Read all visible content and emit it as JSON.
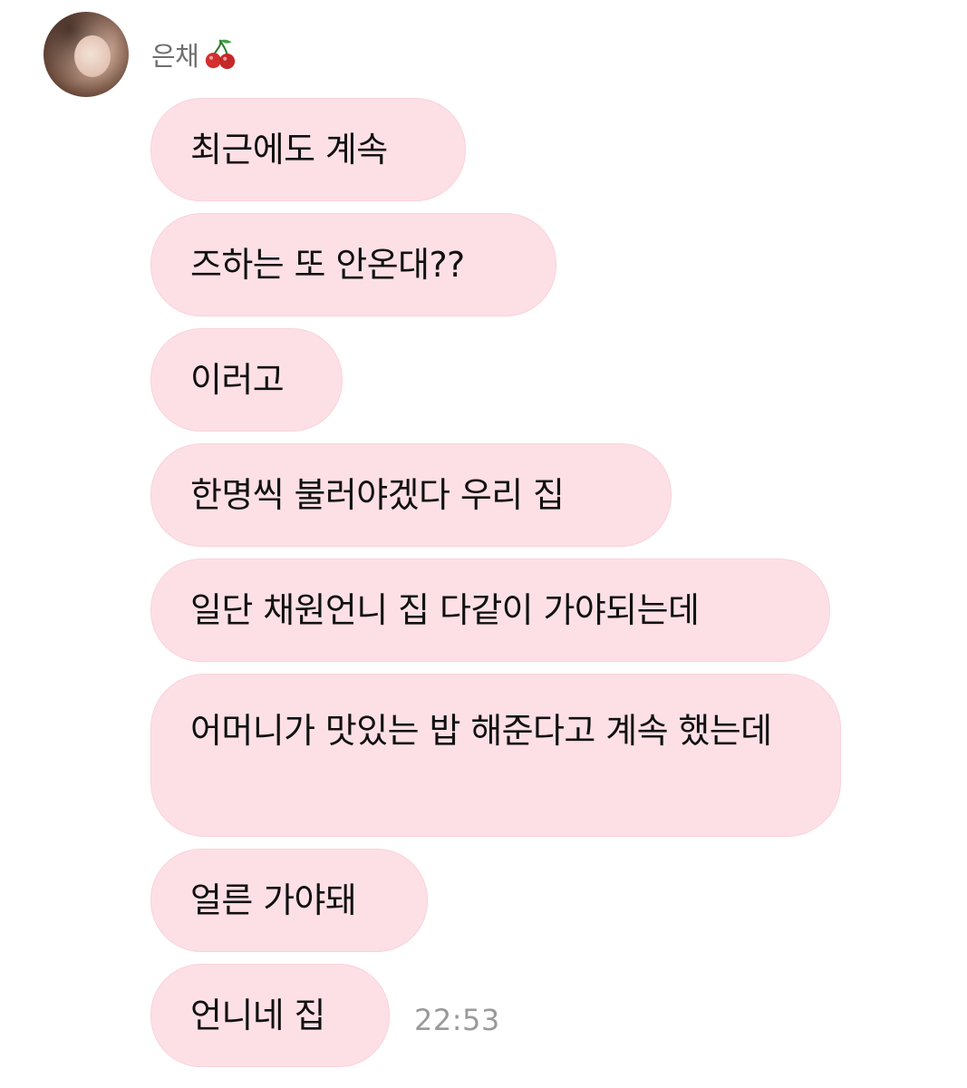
{
  "chat": {
    "sender_name": "은채",
    "sender_emoji_icon": "cherry-icon",
    "messages": [
      "최근에도 계속",
      "즈하는 또 안온대??",
      "이러고",
      "한명씩 불러야겠다 우리 집",
      "일단 채원언니 집 다같이 가야되는데",
      "어머니가 맛있는 밥 해준다고 계속 했는데",
      "얼른 가야돼",
      "언니네 집"
    ],
    "last_timestamp": "22:53"
  },
  "colors": {
    "bubble_bg": "#fde0e6",
    "sender_text": "#6f6f6f",
    "timestamp_text": "#9a9a9a"
  }
}
